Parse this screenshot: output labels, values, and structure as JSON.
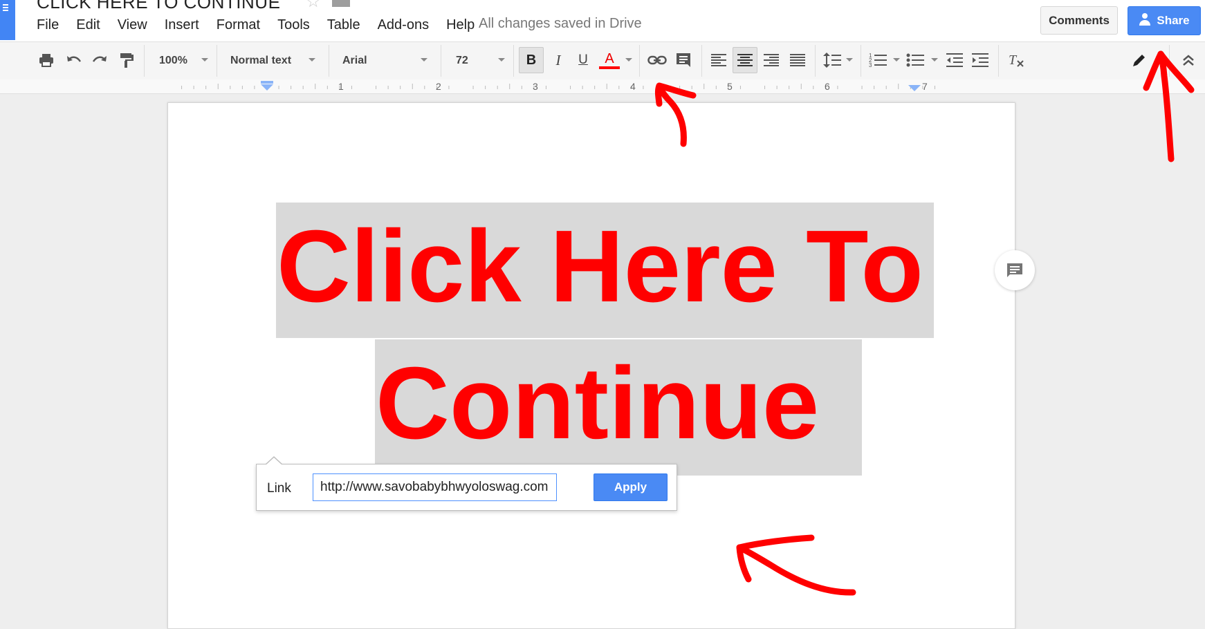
{
  "app": {
    "doc_title": "CLICK HERE TO CONTINUE",
    "menu": [
      "File",
      "Edit",
      "View",
      "Insert",
      "Format",
      "Tools",
      "Table",
      "Add-ons",
      "Help"
    ],
    "save_status": "All changes saved in Drive",
    "comments_label": "Comments",
    "share_label": "Share"
  },
  "toolbar": {
    "zoom": "100%",
    "style": "Normal text",
    "font": "Arial",
    "font_size": "72",
    "bold": "B",
    "italic": "I",
    "underline": "U",
    "text_color": "A",
    "text_color_value": "#ff0000"
  },
  "ruler": {
    "numbers": [
      "1",
      "2",
      "3",
      "4",
      "5",
      "6",
      "7"
    ]
  },
  "document": {
    "line1": "Click Here To",
    "line2": "Continue",
    "text_color": "#ff0000",
    "highlight_color": "#d9d9d9"
  },
  "link_popup": {
    "label": "Link",
    "url": "http://www.savobabybhwyoloswag.com",
    "apply_label": "Apply"
  },
  "icons": [
    "docs-logo-icon",
    "star-icon",
    "folder-icon",
    "share-person-icon",
    "print-icon",
    "undo-icon",
    "redo-icon",
    "paint-format-icon",
    "insert-link-icon",
    "insert-comment-icon",
    "align-left-icon",
    "align-center-icon",
    "align-right-icon",
    "justify-icon",
    "line-spacing-icon",
    "numbered-list-icon",
    "bulleted-list-icon",
    "decrease-indent-icon",
    "increase-indent-icon",
    "clear-formatting-icon",
    "pencil-icon",
    "collapse-icon",
    "comment-bubble-icon"
  ],
  "accent_color": "#4a8af4",
  "annotation_color": "#ff0000"
}
